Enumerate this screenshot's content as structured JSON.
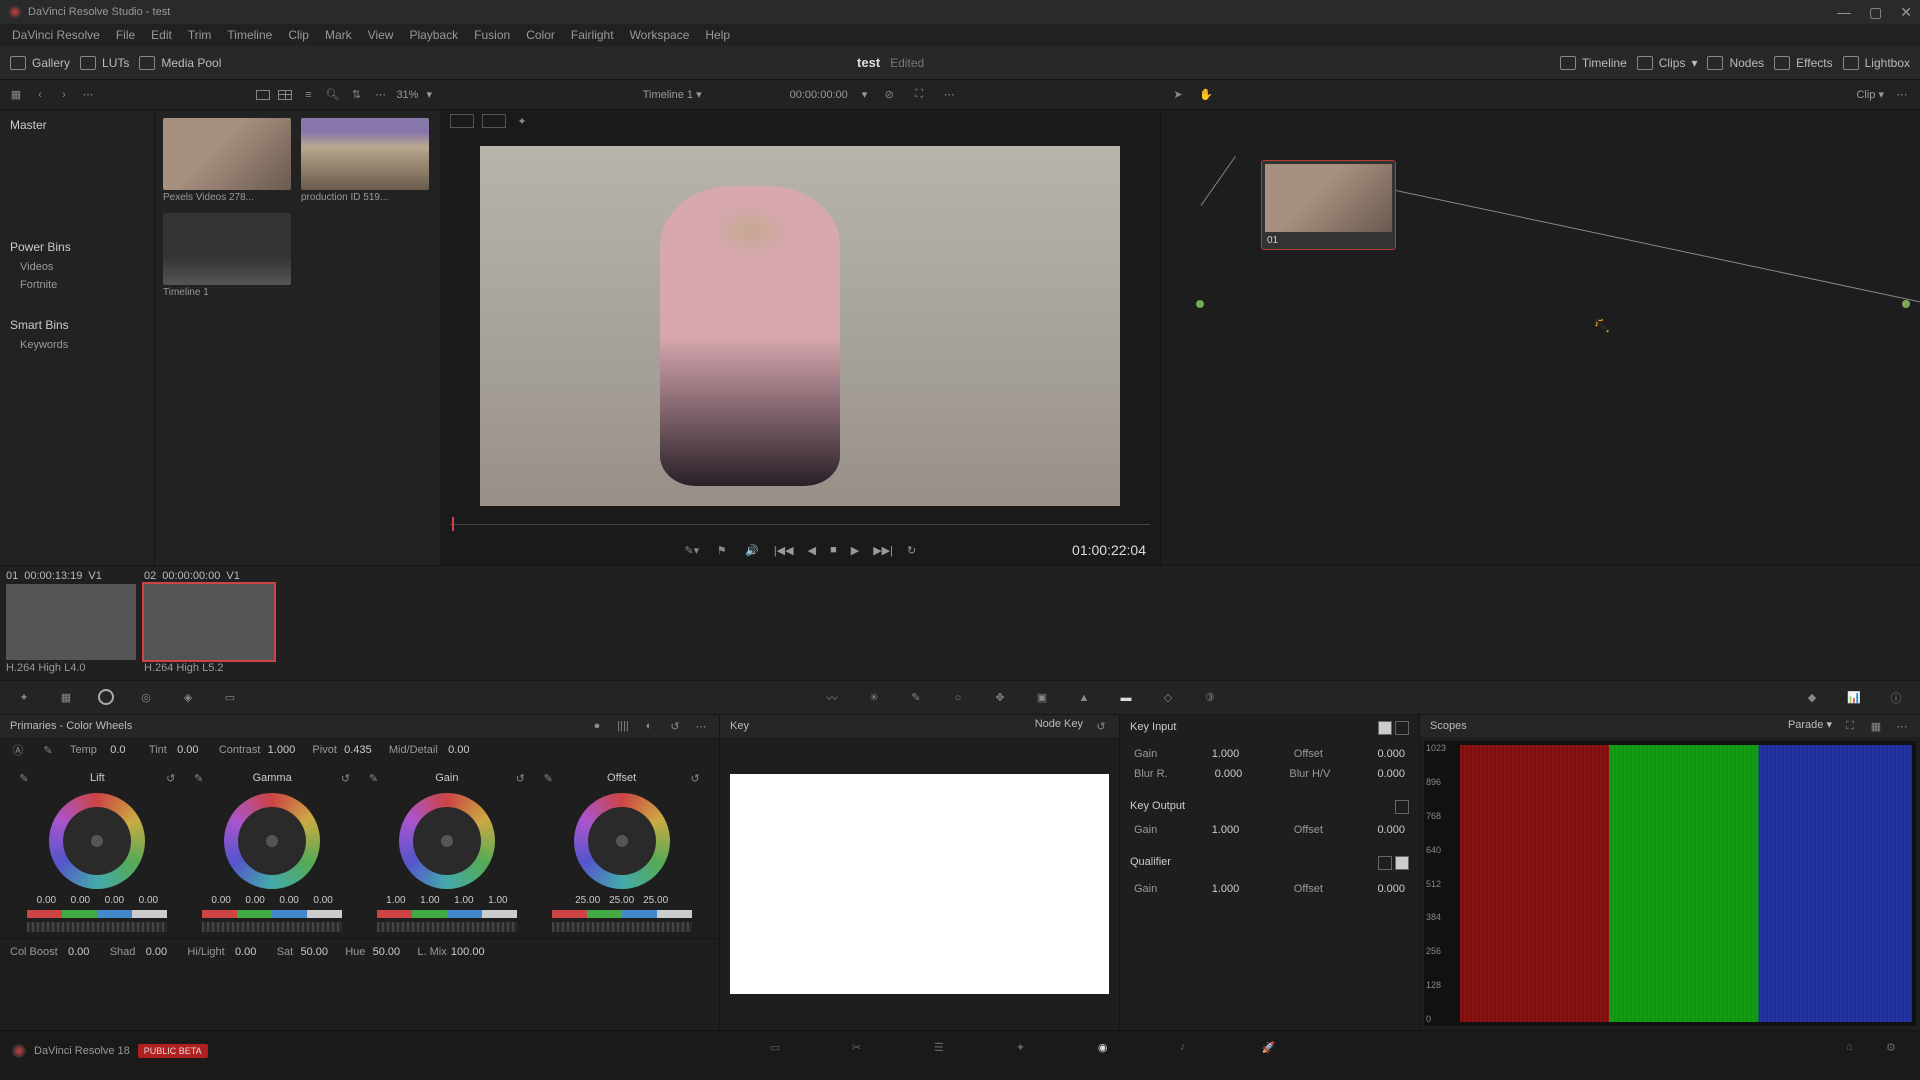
{
  "titlebar": {
    "title": "DaVinci Resolve Studio - test"
  },
  "menu": [
    "DaVinci Resolve",
    "File",
    "Edit",
    "Trim",
    "Timeline",
    "Clip",
    "Mark",
    "View",
    "Playback",
    "Fusion",
    "Color",
    "Fairlight",
    "Workspace",
    "Help"
  ],
  "topbar": {
    "gallery": "Gallery",
    "luts": "LUTs",
    "mediapool": "Media Pool",
    "project": "test",
    "edited": "Edited",
    "timeline_btn": "Timeline",
    "clips_btn": "Clips",
    "nodes_btn": "Nodes",
    "effects_btn": "Effects",
    "lightbox_btn": "Lightbox"
  },
  "subbar": {
    "zoom": "31%",
    "timeline_label": "Timeline 1",
    "timecode": "00:00:00:00",
    "clip_label": "Clip"
  },
  "sidebar": {
    "master": "Master",
    "powerbins": "Power Bins",
    "pb_items": [
      "Videos",
      "Fortnite"
    ],
    "smartbins": "Smart Bins",
    "sb_items": [
      "Keywords"
    ]
  },
  "pool": [
    {
      "label": "Pexels Videos 278..."
    },
    {
      "label": "production ID 519..."
    },
    {
      "label": "Timeline 1"
    }
  ],
  "viewer": {
    "tc": "01:00:22:04"
  },
  "node": {
    "label": "01"
  },
  "clips": [
    {
      "idx": "01",
      "tc": "00:00:13:19",
      "trk": "V1",
      "label": "H.264 High L4.0"
    },
    {
      "idx": "02",
      "tc": "00:00:00:00",
      "trk": "V1",
      "label": "H.264 High L5.2"
    }
  ],
  "prim": {
    "title": "Primaries - Color Wheels",
    "row1": {
      "temp_l": "Temp",
      "temp": "0.0",
      "tint_l": "Tint",
      "tint": "0.00",
      "contrast_l": "Contrast",
      "contrast": "1.000",
      "pivot_l": "Pivot",
      "pivot": "0.435",
      "md_l": "Mid/Detail",
      "md": "0.00"
    },
    "wheels": [
      {
        "name": "Lift",
        "vals": [
          "0.00",
          "0.00",
          "0.00",
          "0.00"
        ]
      },
      {
        "name": "Gamma",
        "vals": [
          "0.00",
          "0.00",
          "0.00",
          "0.00"
        ]
      },
      {
        "name": "Gain",
        "vals": [
          "1.00",
          "1.00",
          "1.00",
          "1.00"
        ]
      },
      {
        "name": "Offset",
        "vals": [
          "25.00",
          "25.00",
          "25.00"
        ]
      }
    ],
    "row2": {
      "cb_l": "Col Boost",
      "cb": "0.00",
      "shad_l": "Shad",
      "shad": "0.00",
      "hl_l": "Hi/Light",
      "hl": "0.00",
      "sat_l": "Sat",
      "sat": "50.00",
      "hue_l": "Hue",
      "hue": "50.00",
      "lm_l": "L. Mix",
      "lm": "100.00"
    }
  },
  "key": {
    "title": "Key",
    "nodekey": "Node Key",
    "input": "Key Input",
    "output": "Key Output",
    "qual": "Qualifier",
    "gain_l": "Gain",
    "offset_l": "Offset",
    "blurr_l": "Blur R.",
    "blurhv_l": "Blur H/V",
    "in_gain": "1.000",
    "in_off": "0.000",
    "in_br": "0.000",
    "in_bhv": "0.000",
    "out_gain": "1.000",
    "out_off": "0.000",
    "q_gain": "1.000",
    "q_off": "0.000"
  },
  "scopes": {
    "title": "Scopes",
    "mode": "Parade",
    "ticks": [
      "1023",
      "896",
      "768",
      "640",
      "512",
      "384",
      "256",
      "128",
      "0"
    ]
  },
  "footer": {
    "app": "DaVinci Resolve 18",
    "beta": "PUBLIC BETA"
  }
}
